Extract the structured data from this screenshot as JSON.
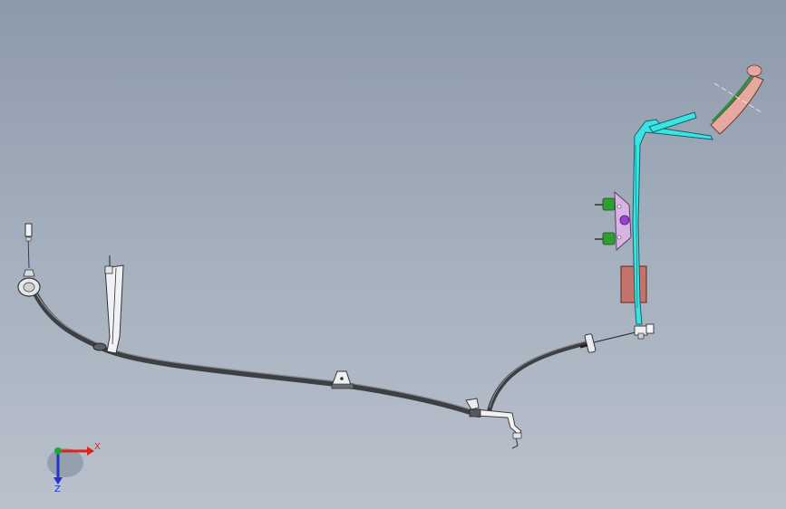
{
  "triad": {
    "x_label": "X",
    "z_label": "Z",
    "x_color": "#e0231b",
    "z_color": "#2432c8",
    "y_color": "#1fa637"
  },
  "colors": {
    "background_top": "#8d9aab",
    "background_bottom": "#b9c1cc",
    "cable": "#4a4d50",
    "cable_highlight": "#8c9094",
    "hardware": "#d8dbe0",
    "pedal_arm": "#38e4e4",
    "pedal_pad": "#e7a8a0",
    "pedal_pad_rim": "#2e8b3c",
    "bracket": "#d9b3e6",
    "grommet": "#2fa02f",
    "block": "#c4736a"
  }
}
